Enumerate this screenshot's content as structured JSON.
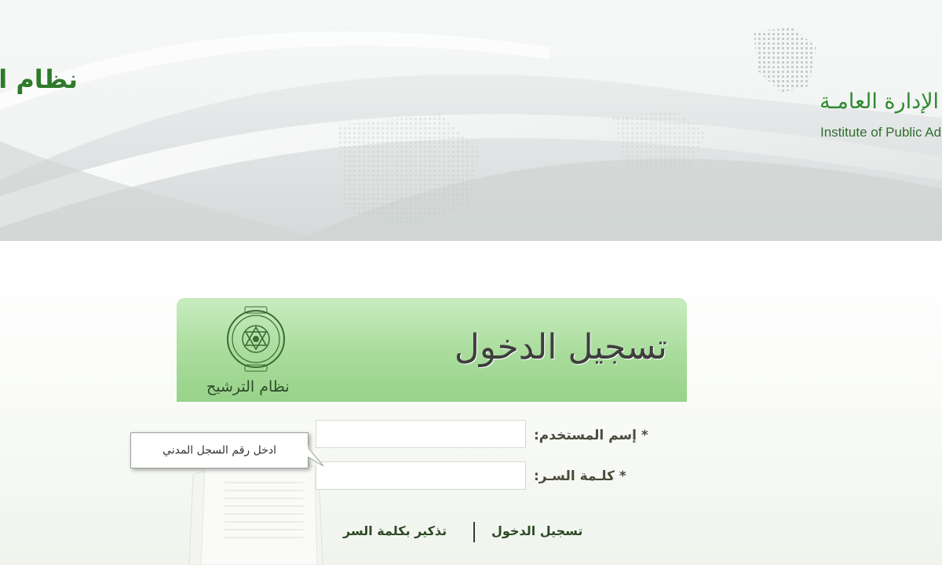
{
  "banner": {
    "system_title": "نظام الترشيح",
    "institute_ar": "معهد الإدارة العامـة",
    "institute_en": "Institute of Public Administration"
  },
  "login": {
    "title": "تسجيل الدخول",
    "system_name": "نظام الترشيح",
    "emblem_icon": "ipa-emblem-icon"
  },
  "form": {
    "username_label": "* إسم المستخدم:",
    "username_value": "",
    "password_label": "* كلـمة السـر:",
    "password_value": ""
  },
  "tooltip": {
    "text": "ادخل رقم السجل المدني"
  },
  "links": {
    "login": "تسجيل الدخول",
    "forgot_password": "تذكير بكلمة السر"
  },
  "colors": {
    "brand_green": "#2f8a2e",
    "header_green": "#a8dc9b",
    "text_dark": "#3e3e3e"
  }
}
